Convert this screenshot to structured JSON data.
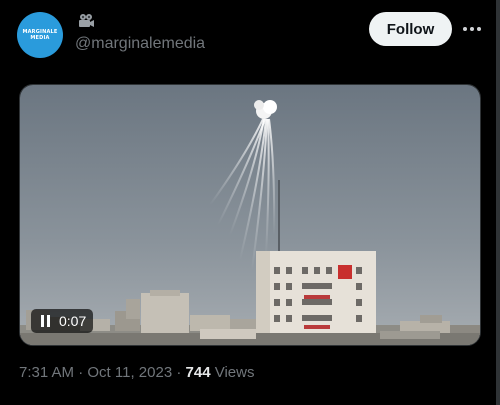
{
  "post": {
    "author": {
      "avatar_text_line1": "MARGINALE",
      "avatar_text_line2": "MEDIA",
      "avatar_color": "#2a9bdc",
      "handle": "@marginalemedia",
      "badge_icon": "camera-emoji-icon"
    },
    "follow_label": "Follow",
    "more_icon": "more-options-icon",
    "video": {
      "state_icon": "pause-icon",
      "elapsed": "0:07"
    },
    "meta": {
      "time": "7:31 AM",
      "separator_1": " · ",
      "date": "Oct 11, 2023",
      "separator_2": " · ",
      "view_count": "744",
      "views_label": "Views"
    }
  },
  "colors": {
    "background": "#000000",
    "text_primary": "#e7e9ea",
    "text_secondary": "#71767b",
    "follow_bg": "#eff3f4",
    "follow_text": "#0f1419"
  }
}
